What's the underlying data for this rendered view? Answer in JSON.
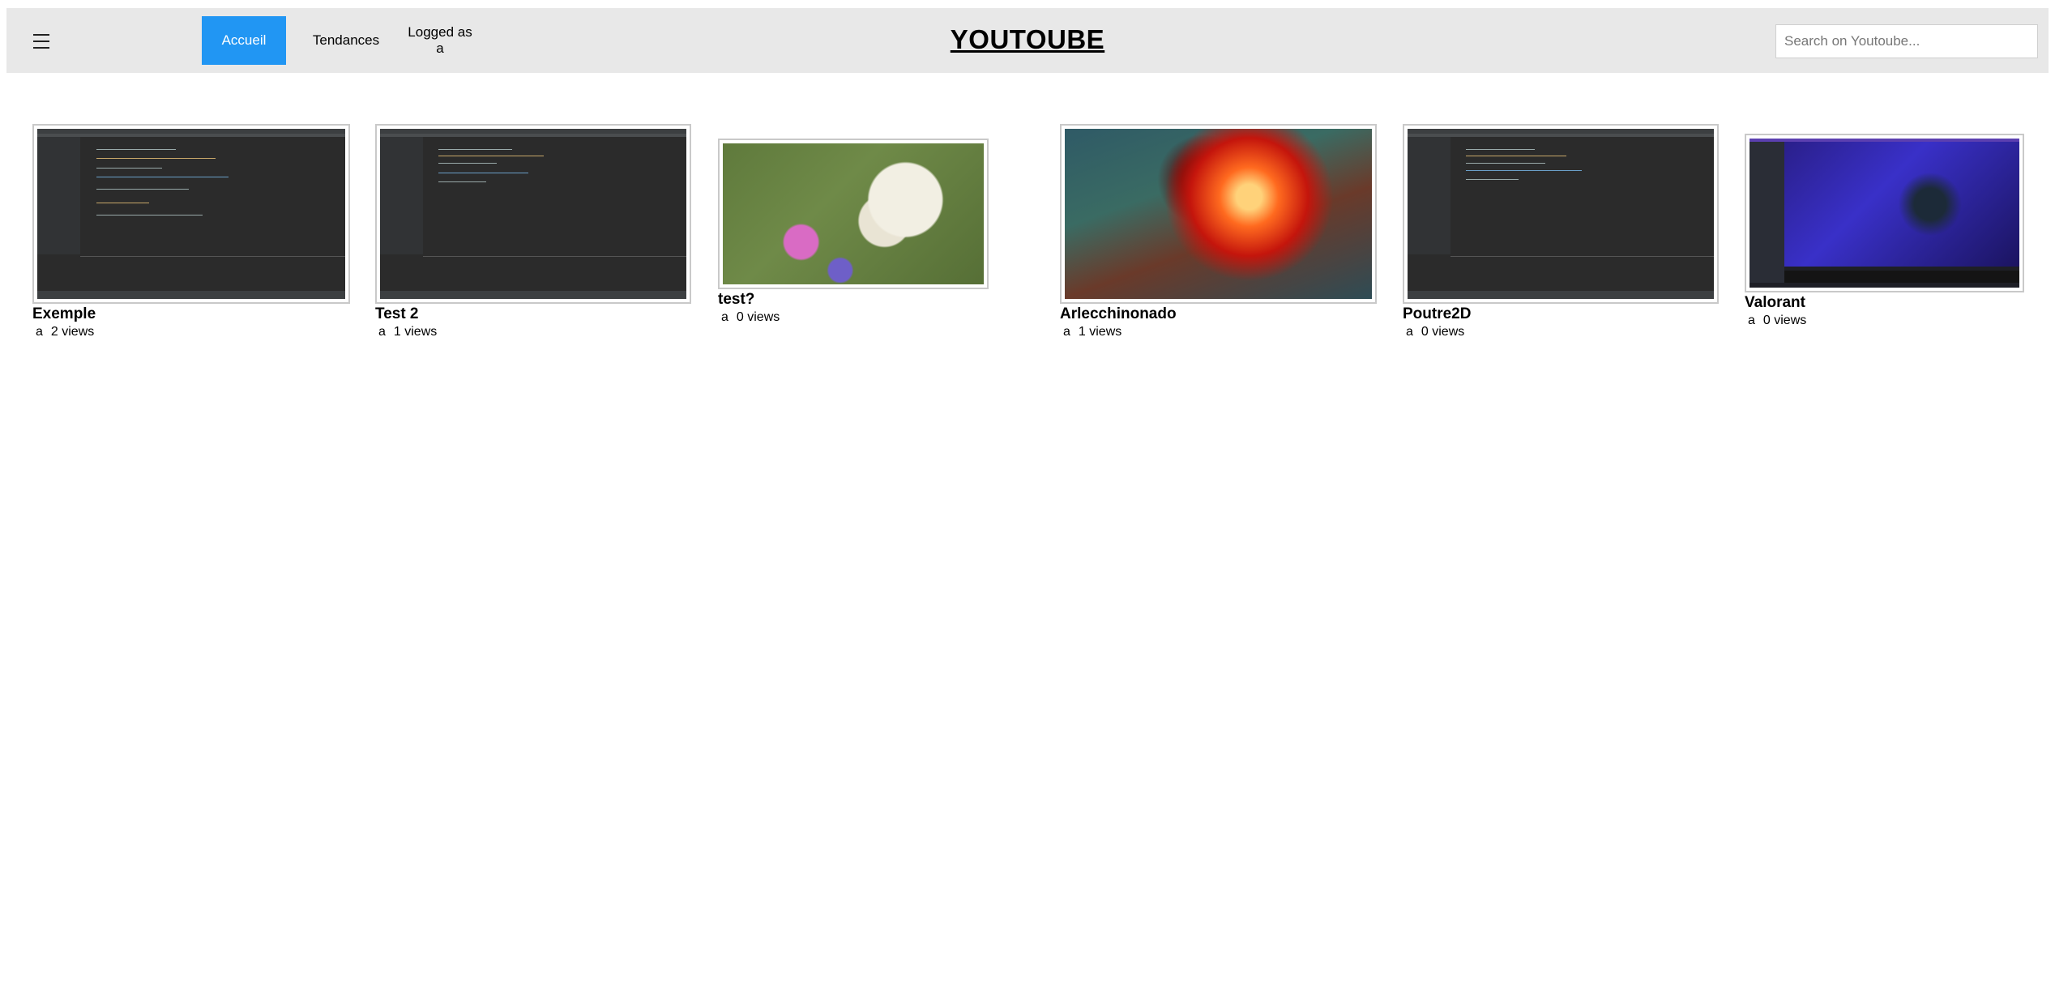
{
  "header": {
    "menu_icon": "hamburger-menu-icon",
    "nav": {
      "home": "Accueil",
      "trends": "Tendances",
      "logged": "Logged as a"
    },
    "brand": "YOUTOUBE",
    "search": {
      "placeholder": "Search on Youtoube...",
      "value": ""
    }
  },
  "colors": {
    "header_bg": "#e8e8e8",
    "active_nav_bg": "#2196f3",
    "active_nav_text": "#ffffff"
  },
  "videos": [
    {
      "title": "Exemple",
      "author": "a",
      "views": "2 views",
      "thumbnail": "ide-screenshot"
    },
    {
      "title": "Test 2",
      "author": "a",
      "views": "1 views",
      "thumbnail": "ide-screenshot"
    },
    {
      "title": "test?",
      "author": "a",
      "views": "0 views",
      "thumbnail": "goat-on-grass-game"
    },
    {
      "title": "Arlecchinonado",
      "author": "a",
      "views": "1 views",
      "thumbnail": "fire-battle-game"
    },
    {
      "title": "Poutre2D",
      "author": "a",
      "views": "0 views",
      "thumbnail": "ide-screenshot"
    },
    {
      "title": "Valorant",
      "author": "a",
      "views": "0 views",
      "thumbnail": "valorant-stream"
    }
  ]
}
